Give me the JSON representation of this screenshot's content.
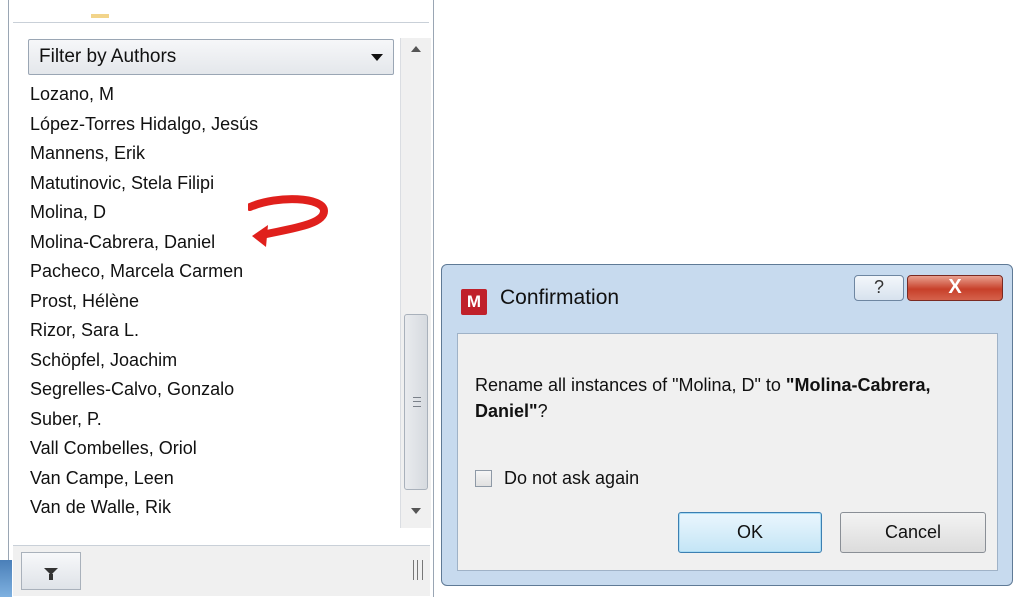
{
  "panel": {
    "filter_label": "Filter by Authors",
    "authors": [
      "Lozano, M",
      "López-Torres Hidalgo, Jesús",
      "Mannens, Erik",
      "Matutinovic, Stela Filipi",
      "Molina, D",
      "Molina-Cabrera, Daniel",
      "Pacheco, Marcela Carmen",
      "Prost, Hélène",
      "Rizor, Sara L.",
      "Schöpfel, Joachim",
      "Segrelles-Calvo, Gonzalo",
      "Suber, P.",
      "Vall Combelles, Oriol",
      "Van Campe, Leen",
      "Van de Walle, Rik"
    ],
    "icons": {
      "dropdown": "chevron-down-icon",
      "scroll_up": "arrow-up-icon",
      "scroll_down": "arrow-down-icon",
      "filter": "funnel-icon"
    }
  },
  "annotation": {
    "arrow_color": "#e0201c"
  },
  "dialog": {
    "title": "Confirmation",
    "app_icon_text": "M",
    "help_label": "?",
    "close_label": "X",
    "message_pre": "Rename all instances of \"Molina, D\" to ",
    "message_bold": "\"Molina-Cabrera, Daniel\"",
    "message_post": "?",
    "checkbox_label": "Do not ask again",
    "checkbox_checked": false,
    "ok_label": "OK",
    "cancel_label": "Cancel",
    "colors": {
      "frame": "#c7daee",
      "close": "#c7402a",
      "app_icon": "#c0202a"
    }
  }
}
